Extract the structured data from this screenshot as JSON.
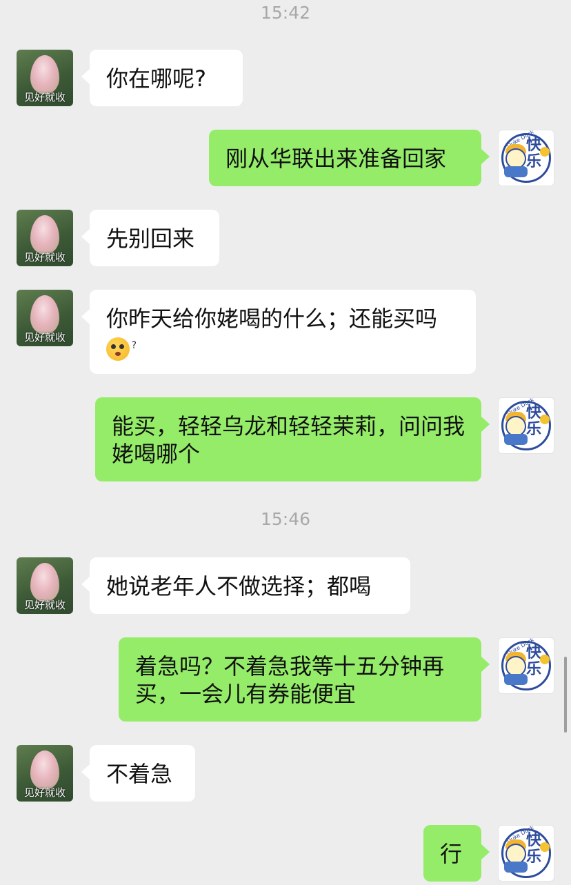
{
  "timestamps": [
    "15:42",
    "15:46"
  ],
  "contact_avatar_caption": "见好就收",
  "self_avatar": {
    "text_1": "快",
    "text_2": "乐",
    "small": "Duke Duck",
    "ing": "ing"
  },
  "messages": [
    {
      "side": "recv",
      "text": "你在哪呢?"
    },
    {
      "side": "sent",
      "text": "刚从华联出来准备回家"
    },
    {
      "side": "recv",
      "text": "先别回来"
    },
    {
      "side": "recv",
      "text": "你昨天给你姥喝的什么；还能买吗"
    },
    {
      "side": "sent",
      "text": "能买，轻轻乌龙和轻轻茉莉，问问我姥喝哪个"
    },
    {
      "side": "recv",
      "text": "她说老年人不做选择；都喝"
    },
    {
      "side": "sent",
      "text": "着急吗？不着急我等十五分钟再买，一会儿有券能便宜"
    },
    {
      "side": "recv",
      "text": "不着急"
    },
    {
      "side": "sent",
      "text": "行"
    }
  ],
  "emoji": {
    "name": "shy-face-emoji",
    "question": "?"
  },
  "colors": {
    "sent_bubble": "#95ec69",
    "recv_bubble": "#ffffff",
    "background": "#ededed",
    "timestamp": "#a8a8a8"
  }
}
